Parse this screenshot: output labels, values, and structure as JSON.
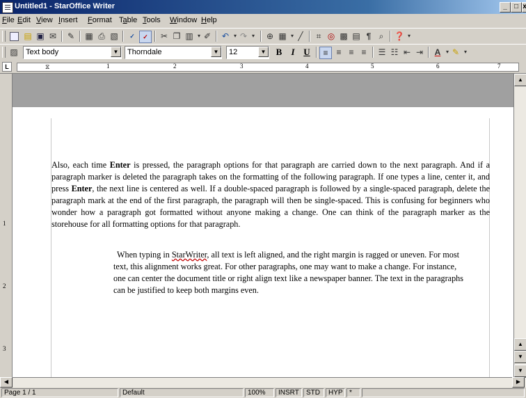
{
  "window": {
    "title": "Untitled1 - StarOffice Writer"
  },
  "menubar": {
    "items": [
      {
        "accel": "F",
        "rest": "ile"
      },
      {
        "accel": "E",
        "rest": "dit"
      },
      {
        "accel": "V",
        "rest": "iew"
      },
      {
        "accel": "I",
        "rest": "nsert"
      },
      {
        "accel": "F",
        "rest": "ormat",
        "pre": "F",
        "mid": "o"
      },
      {
        "accel": "a",
        "rest": "ble",
        "pre": "T"
      },
      {
        "accel": "T",
        "rest": "ools"
      },
      {
        "accel": "W",
        "rest": "indow"
      },
      {
        "accel": "H",
        "rest": "elp"
      }
    ]
  },
  "formatting": {
    "paragraph_style": "Text body",
    "font_name": "Thorndale",
    "font_size": "12",
    "bold": "B",
    "italic": "I",
    "underline": "U"
  },
  "ruler": {
    "numbers": [
      "1",
      "2",
      "3",
      "4",
      "5",
      "6",
      "7"
    ],
    "tab_marker": "L"
  },
  "vruler": {
    "numbers": [
      "1",
      "2",
      "3"
    ]
  },
  "document": {
    "para1": {
      "t1": "Also, each time ",
      "b1": "Enter",
      "t2": " is pressed, the paragraph options for that paragraph are carried down to the next paragraph. And if a paragraph marker is deleted the paragraph takes on the formatting of the following paragraph. If one types a line, center it, and press ",
      "b2": "Enter",
      "t3": ", the next line is centered as well. If a double-spaced paragraph is followed by a single-spaced paragraph, delete the paragraph mark at the end of the first paragraph, the paragraph will then be single-spaced. This is confusing for beginners who wonder how a paragraph got formatted without anyone making a change. One can think of the paragraph marker as the storehouse for all formatting options for that paragraph."
    },
    "para2": {
      "t1": "When typing in ",
      "misspelled": "StarWriter",
      "t2": ", all text is left aligned, and the right margin is ragged or uneven. For most text, this alignment works great. For other paragraphs, one may want to make a change. For instance, one can center the document title or right align text like a newspaper banner. The text in the paragraphs can be justified to keep both margins even."
    }
  },
  "statusbar": {
    "page": "Page 1 / 1",
    "page_style": "Default",
    "zoom": "100%",
    "insert_mode": "INSRT",
    "selection_mode": "STD",
    "hyperlink_mode": "HYP",
    "modified": "*"
  }
}
